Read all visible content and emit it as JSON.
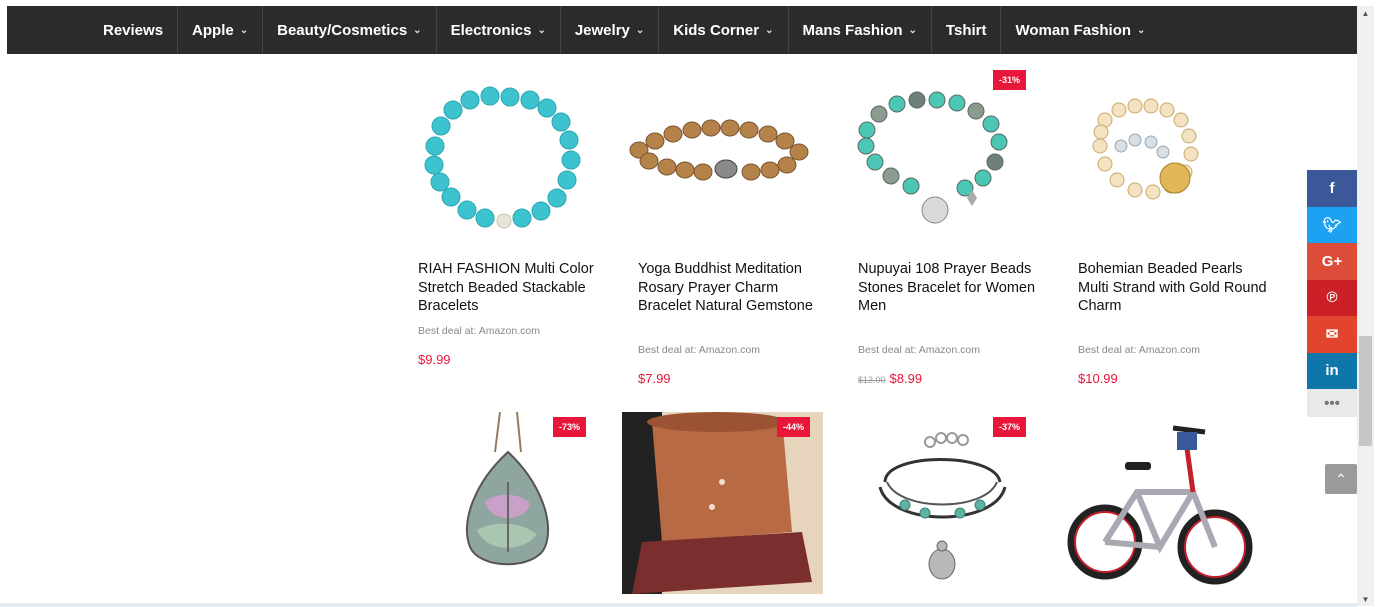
{
  "nav": {
    "items": [
      {
        "label": "Reviews",
        "dropdown": false
      },
      {
        "label": "Apple",
        "dropdown": true
      },
      {
        "label": "Beauty/Cosmetics",
        "dropdown": true
      },
      {
        "label": "Electronics",
        "dropdown": true
      },
      {
        "label": "Jewelry",
        "dropdown": true
      },
      {
        "label": "Kids Corner",
        "dropdown": true
      },
      {
        "label": "Mans Fashion",
        "dropdown": true
      },
      {
        "label": "Tshirt",
        "dropdown": false
      },
      {
        "label": "Woman Fashion",
        "dropdown": true
      }
    ]
  },
  "products": [
    {
      "title": "RIAH FASHION Multi Color Stretch Beaded Stackable Bracelets",
      "deal": "Best deal at: Amazon.com",
      "price": "$9.99",
      "old_price": "",
      "badge": "",
      "image": "turquoise-bead-bracelet"
    },
    {
      "title": "Yoga Buddhist Meditation Rosary Prayer Charm Bracelet Natural Gemstone",
      "deal": "Best deal at: Amazon.com",
      "price": "$7.99",
      "old_price": "",
      "badge": "",
      "image": "brown-bead-bracelet"
    },
    {
      "title": "Nupuyai 108 Prayer Beads Stones Bracelet for Women Men",
      "deal": "Best deal at: Amazon.com",
      "price": "$8.99",
      "old_price": "$13.00",
      "badge": "-31%",
      "image": "turquoise-charm-bracelet"
    },
    {
      "title": "Bohemian Beaded Pearls Multi Strand with Gold Round Charm",
      "deal": "Best deal at: Amazon.com",
      "price": "$10.99",
      "old_price": "",
      "badge": "",
      "image": "pearl-strand-bracelet"
    },
    {
      "title": "",
      "deal": "",
      "price": "",
      "old_price": "",
      "badge": "-73%",
      "image": "tree-of-life-pendant"
    },
    {
      "title": "",
      "deal": "",
      "price": "",
      "old_price": "",
      "badge": "-44%",
      "image": "terracotta-planter"
    },
    {
      "title": "",
      "deal": "",
      "price": "",
      "old_price": "",
      "badge": "-37%",
      "image": "turtle-charm-bracelet"
    },
    {
      "title": "",
      "deal": "",
      "price": "",
      "old_price": "",
      "badge": "",
      "image": "kids-bicycle"
    }
  ],
  "share": {
    "buttons": [
      {
        "label": "f",
        "color": "#3b5998",
        "icon": "facebook-icon"
      },
      {
        "label": "🐦",
        "color": "#1da1f2",
        "icon": "twitter-icon"
      },
      {
        "label": "G+",
        "color": "#dd4b39",
        "icon": "google-plus-icon"
      },
      {
        "label": "℗",
        "color": "#cb2027",
        "icon": "pinterest-icon"
      },
      {
        "label": "✉",
        "color": "#e2452d",
        "icon": "email-icon"
      },
      {
        "label": "in",
        "color": "#0e76a8",
        "icon": "linkedin-icon"
      }
    ],
    "more": "•••"
  },
  "to_top": "⌃",
  "colors": {
    "accent": "#e8173a",
    "nav_bg": "#2b2b2b"
  }
}
